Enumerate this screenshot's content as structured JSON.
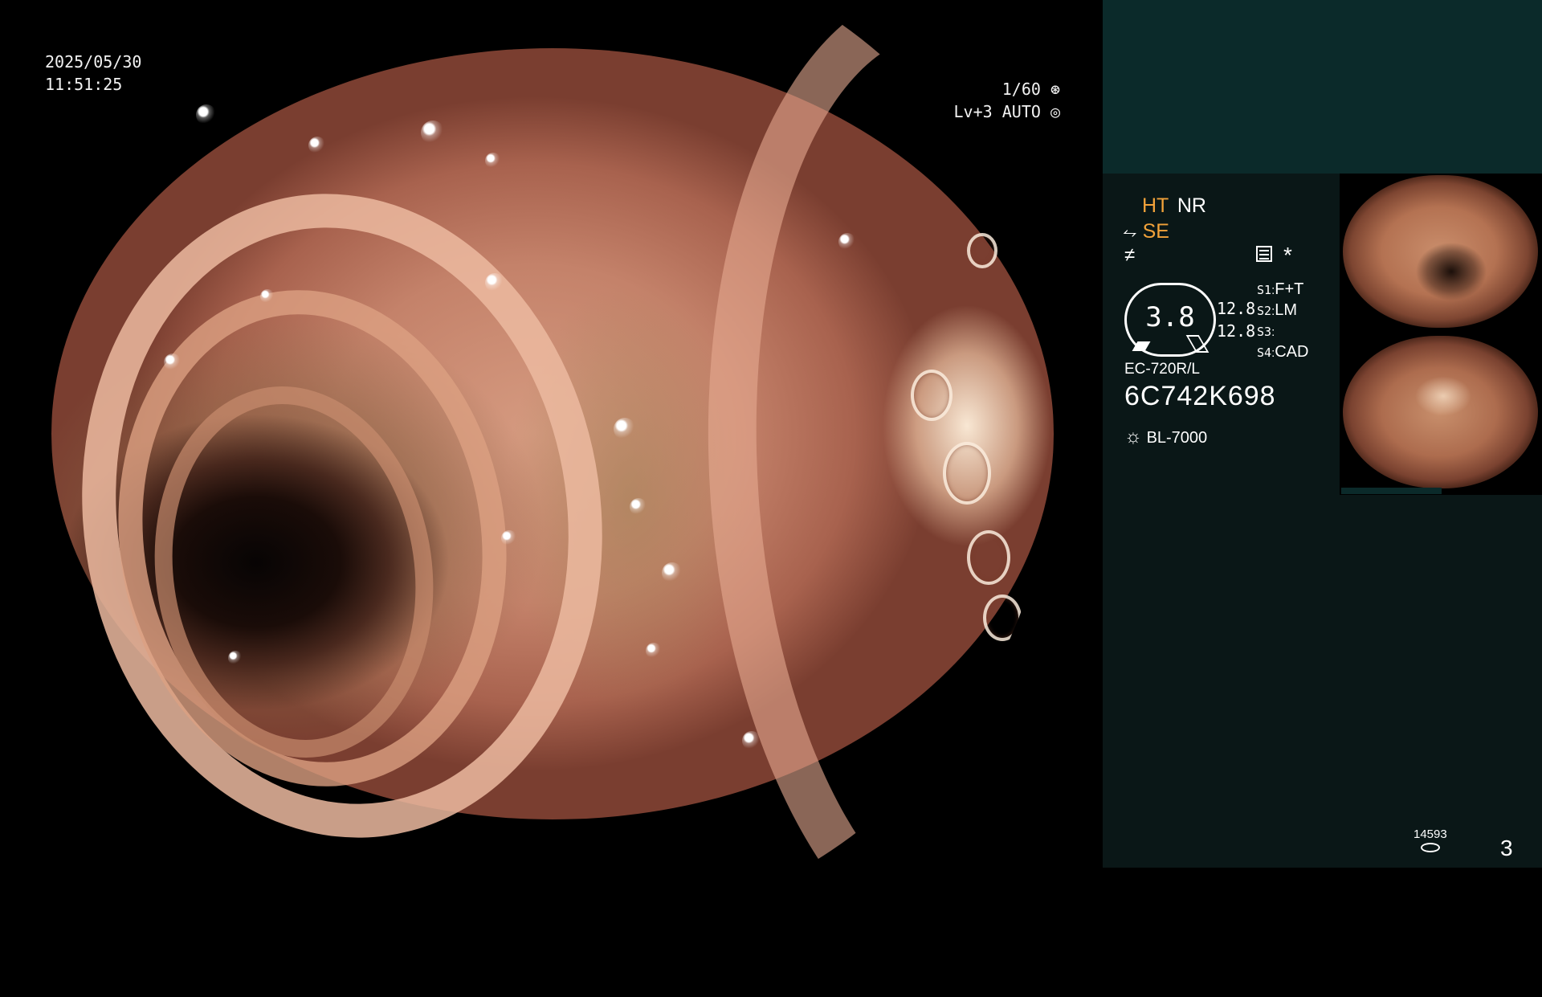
{
  "datetime": {
    "date": "2025/05/30",
    "time": "11:51:25"
  },
  "exposure": {
    "shutter": "1/60",
    "level": "Lv+3",
    "mode": "AUTO"
  },
  "settings": {
    "ht": "HT",
    "nr": "NR",
    "se": "SE",
    "asterisk": "*",
    "gauge_value": "3.8",
    "left_values": [
      "12.8",
      "12.8"
    ],
    "switches": [
      {
        "key": "S1",
        "value": "F+T"
      },
      {
        "key": "S2",
        "value": "LM"
      },
      {
        "key": "S3",
        "value": ""
      },
      {
        "key": "S4",
        "value": "CAD"
      }
    ]
  },
  "scope": {
    "model": "EC-720R/L",
    "serial": "6C742K698"
  },
  "light_source": "BL-7000",
  "footer": {
    "count": "14593",
    "page": "3"
  },
  "colors": {
    "accent": "#f2a23a",
    "panel": "#0a1717",
    "panel_top": "#0b2a2a"
  }
}
